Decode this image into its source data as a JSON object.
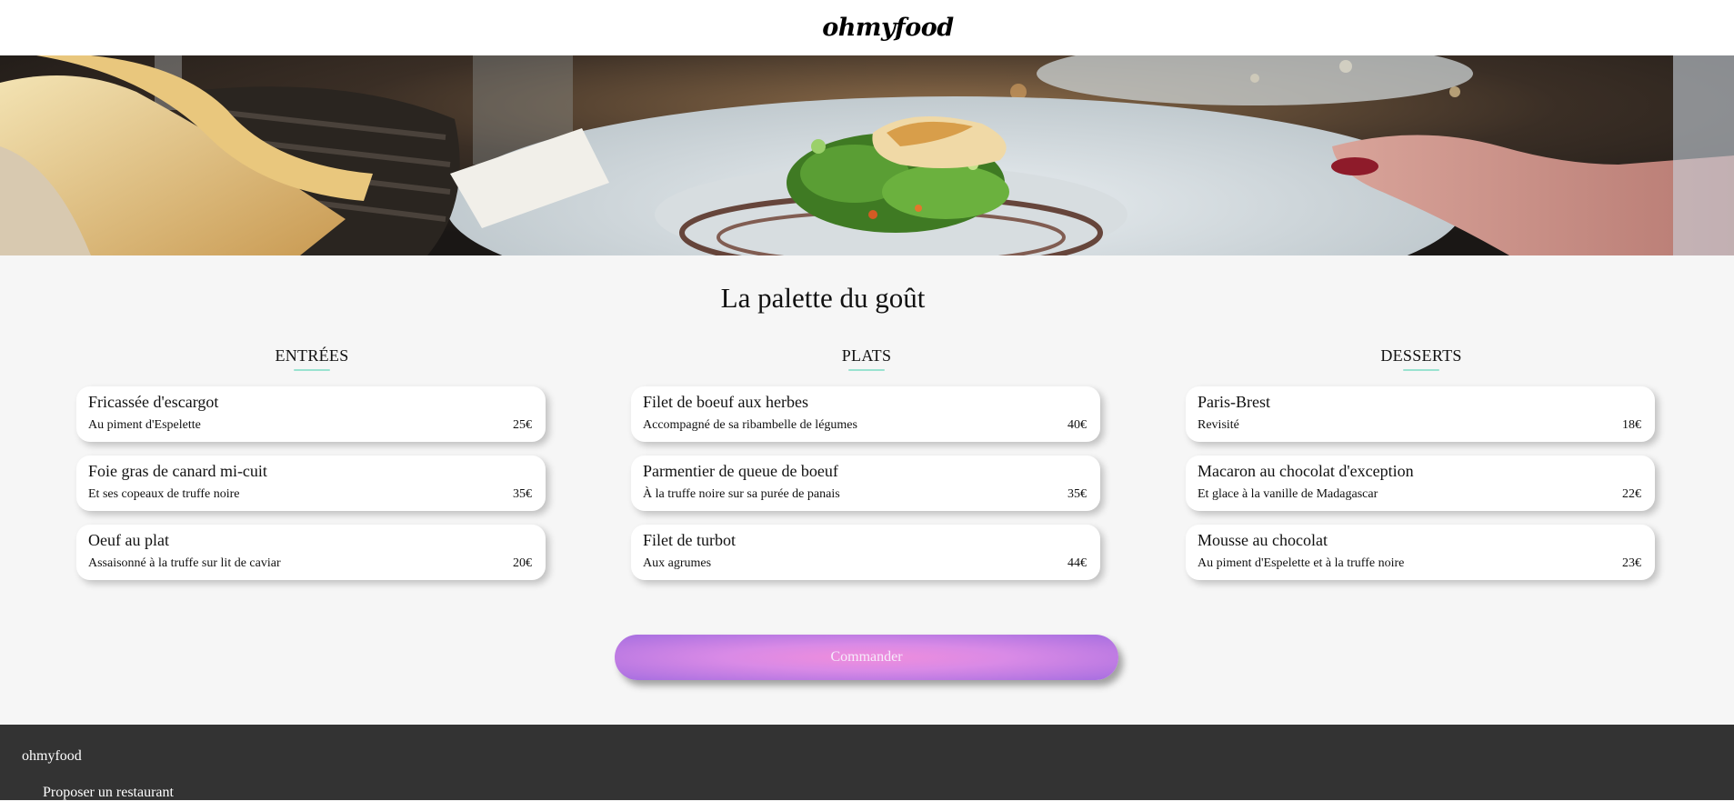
{
  "header": {
    "logo": "ohmyfood"
  },
  "hero": {
    "description_icon": "restaurant-photo"
  },
  "menu": {
    "title": "La palette du goût",
    "columns": [
      {
        "title": "ENTRÉES",
        "items": [
          {
            "name": "Fricassée d'escargot",
            "desc": "Au piment d'Espelette",
            "price": "25€"
          },
          {
            "name": "Foie gras de canard mi-cuit",
            "desc": "Et ses copeaux de truffe noire",
            "price": "35€"
          },
          {
            "name": "Oeuf au plat",
            "desc": "Assaisonné à la truffe sur lit de caviar",
            "price": "20€"
          }
        ]
      },
      {
        "title": "PLATS",
        "items": [
          {
            "name": "Filet de boeuf aux herbes",
            "desc": "Accompagné de sa ribambelle de légumes",
            "price": "40€"
          },
          {
            "name": "Parmentier de queue de boeuf",
            "desc": "À la truffe noire sur sa purée de panais",
            "price": "35€"
          },
          {
            "name": "Filet de turbot",
            "desc": "Aux agrumes",
            "price": "44€"
          }
        ]
      },
      {
        "title": "DESSERTS",
        "items": [
          {
            "name": "Paris-Brest",
            "desc": "Revisité",
            "price": "18€"
          },
          {
            "name": "Macaron au chocolat d'exception",
            "desc": "Et glace à la vanille de Madagascar",
            "price": "22€"
          },
          {
            "name": "Mousse au chocolat",
            "desc": "Au piment d'Espelette et à la truffe noire",
            "price": "23€"
          }
        ]
      }
    ]
  },
  "order": {
    "label": "Commander"
  },
  "footer": {
    "title": "ohmyfood",
    "link": "Proposer un restaurant"
  },
  "colors": {
    "accent_underline": "#99e2d0",
    "button_center": "#f08ddc",
    "button_edge": "#a66ee0",
    "footer_bg": "#333333"
  }
}
